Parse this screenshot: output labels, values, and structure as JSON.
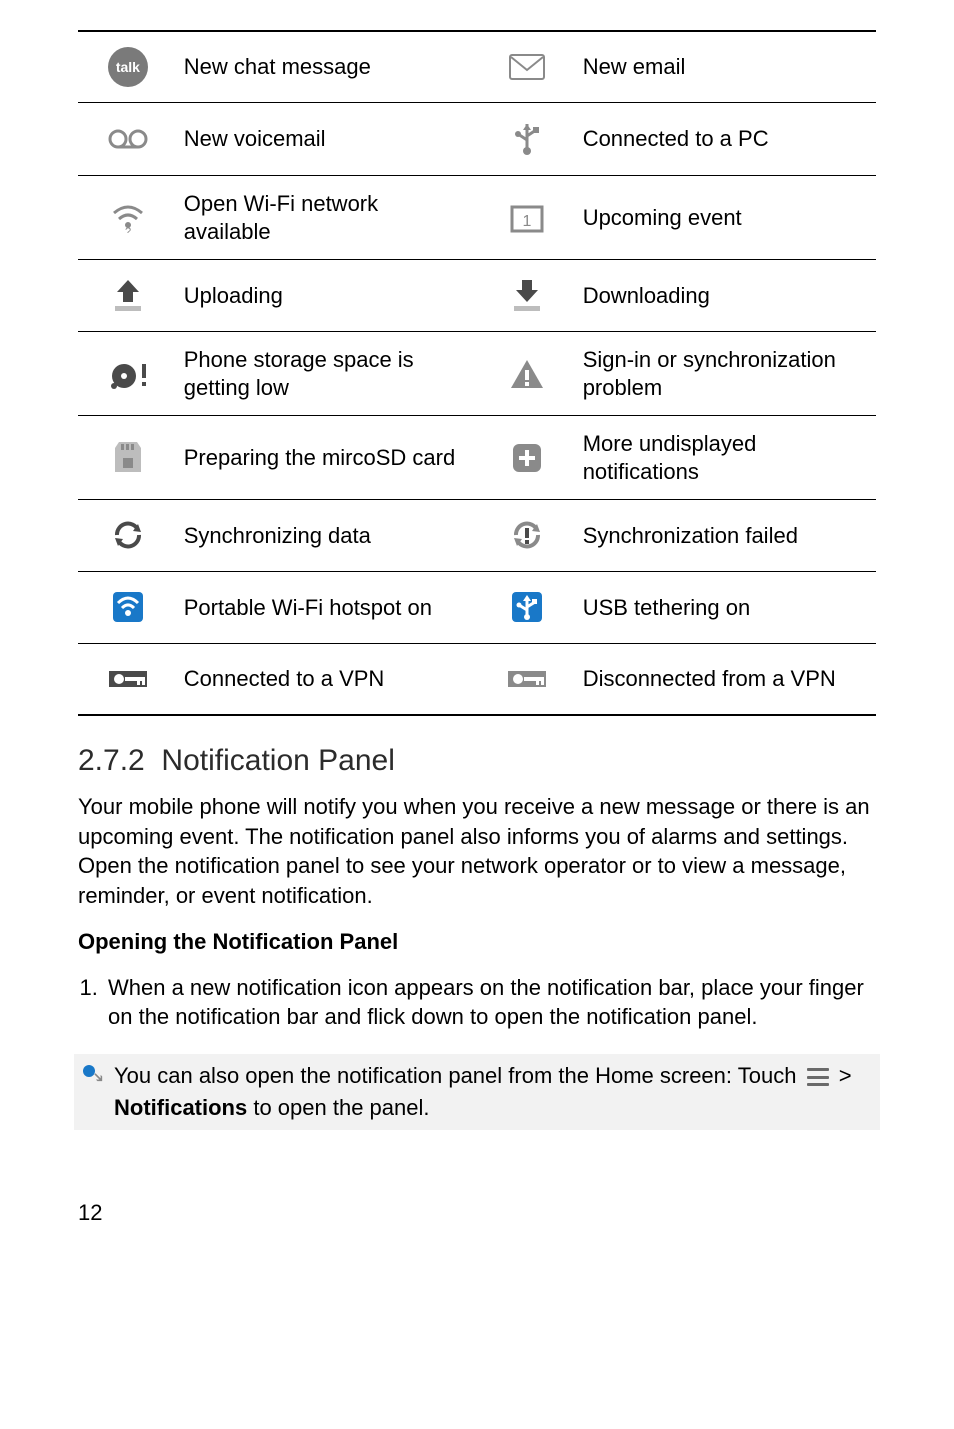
{
  "icon_rows": [
    {
      "left_label": "New chat message",
      "right_label": "New email"
    },
    {
      "left_label": "New voicemail",
      "right_label": "Connected to a PC"
    },
    {
      "left_label": "Open Wi-Fi network available",
      "right_label": "Upcoming event"
    },
    {
      "left_label": "Uploading",
      "right_label": "Downloading"
    },
    {
      "left_label": "Phone storage space is getting low",
      "right_label": "Sign-in or synchronization problem"
    },
    {
      "left_label": "Preparing the mircoSD card",
      "right_label": "More undisplayed notifications"
    },
    {
      "left_label": "Synchronizing data",
      "right_label": "Synchronization failed"
    },
    {
      "left_label": "Portable Wi-Fi hotspot on",
      "right_label": "USB tethering on"
    },
    {
      "left_label": "Connected to a VPN",
      "right_label": "Disconnected from a VPN"
    }
  ],
  "talk_label": "talk",
  "section": {
    "number": "2.7.2",
    "title": "Notification Panel",
    "paragraph": "Your mobile phone will notify you when you receive a new message or there is an upcoming event. The notification panel also informs you of alarms and settings. Open the notification panel to see your network operator or to view a message, reminder, or event notification.",
    "subhead": "Opening the Notification Panel",
    "step1": "When a new notification icon appears on the notification bar, place your finger on the notification bar and flick down to open the notification panel.",
    "tip_pre": "You can also open the notification panel from the Home screen: Touch ",
    "tip_post_gt": " > ",
    "tip_bold": "Notifications",
    "tip_tail": " to open the panel."
  },
  "page_number": "12"
}
